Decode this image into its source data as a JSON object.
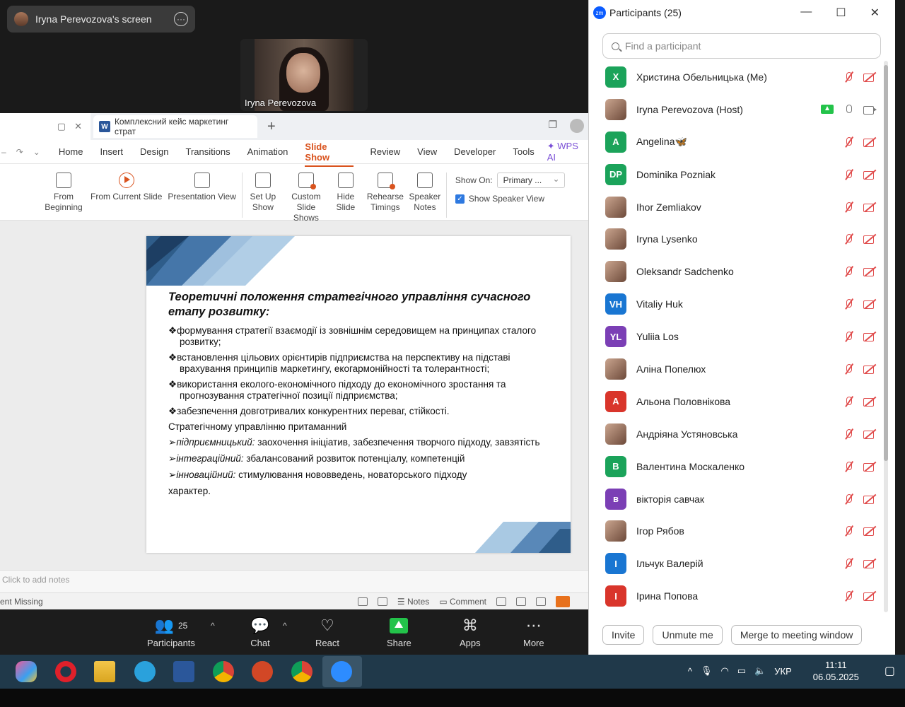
{
  "zoom": {
    "share_label": "Iryna Perevozova's screen",
    "video_name": "Iryna Perevozova",
    "toolbar": {
      "participants_label": "Participants",
      "participants_count": "25",
      "chat_label": "Chat",
      "react_label": "React",
      "share_label": "Share",
      "apps_label": "Apps",
      "more_label": "More"
    }
  },
  "wps": {
    "doc_tab": "Комплексний кейс маркетинг страт",
    "menu": [
      "Home",
      "Insert",
      "Design",
      "Transitions",
      "Animation",
      "Slide Show",
      "Review",
      "View",
      "Developer",
      "Tools"
    ],
    "active_menu": "Slide Show",
    "wps_ai": "WPS AI",
    "ribbon": {
      "from_beginning": "From Beginning",
      "from_current": "From Current Slide",
      "presentation_view": "Presentation View",
      "set_up_show": "Set Up Show",
      "custom_slide_shows": "Custom Slide Shows",
      "hide_slide": "Hide Slide",
      "rehearse_timings": "Rehearse Timings",
      "speaker_notes": "Speaker Notes",
      "show_on_label": "Show On:",
      "show_on_value": "Primary ...",
      "show_speaker_view": "Show Speaker View"
    },
    "slide": {
      "title": "Теоретичні положення стратегічного управління сучасного етапу розвитку:",
      "bullets": [
        "формування стратегії взаємодії із зовнішнім середовищем на принципах сталого розвитку;",
        "встановлення цільових орієнтирів підприємства на перспективу на підставі врахування принципів маркетингу, екогармонійності та толерантності;",
        "використання еколого-економічного підходу до економічного зростання та прогнозування стратегічної позиції підприємства;",
        "забезпечення довготривалих конкурентних переваг, стійкості."
      ],
      "intro": "Стратегічному управлінню притаманний",
      "arrows": [
        {
          "term": "підприємницький:",
          "text": " заохочення ініціатив, забезпечення творчого підходу, завзятість"
        },
        {
          "term": "інтеграційний:",
          "text": " збалансований розвиток потенціалу, компетенцій"
        },
        {
          "term": "інноваційний:",
          "text": " стимулювання нововведень, новаторського підходу"
        }
      ],
      "ending": "характер."
    },
    "notes_placeholder": "Click to add notes",
    "status_left": "ent Missing",
    "status_notes": "Notes",
    "status_comment": "Comment"
  },
  "participants": {
    "title": "Participants (25)",
    "search_placeholder": "Find a participant",
    "list": [
      {
        "name": "Христина Обельницька (Me)",
        "initials": "Х",
        "color": "#1ba35a",
        "photo": false,
        "host": false
      },
      {
        "name": "Iryna Perevozova (Host)",
        "initials": "",
        "color": "",
        "photo": true,
        "host": true
      },
      {
        "name": "Angelina🦋",
        "initials": "A",
        "color": "#1ba35a",
        "photo": false,
        "host": false
      },
      {
        "name": "Dominika Pozniak",
        "initials": "DP",
        "color": "#1ba35a",
        "photo": false,
        "host": false
      },
      {
        "name": "Ihor Zemliakov",
        "initials": "",
        "color": "",
        "photo": true,
        "host": false
      },
      {
        "name": "Iryna Lysenko",
        "initials": "",
        "color": "",
        "photo": true,
        "host": false
      },
      {
        "name": "Oleksandr Sadchenko",
        "initials": "",
        "color": "",
        "photo": true,
        "host": false
      },
      {
        "name": "Vitaliy Huk",
        "initials": "VH",
        "color": "#1976d2",
        "photo": false,
        "host": false
      },
      {
        "name": "Yuliia Los",
        "initials": "YL",
        "color": "#7b3fb5",
        "photo": false,
        "host": false
      },
      {
        "name": "Аліна Попелюх",
        "initials": "",
        "color": "",
        "photo": true,
        "host": false
      },
      {
        "name": "Альона Половнікова",
        "initials": "A",
        "color": "#d9352b",
        "photo": false,
        "host": false
      },
      {
        "name": "Андріяна Устяновська",
        "initials": "",
        "color": "",
        "photo": true,
        "host": false
      },
      {
        "name": "Валентина Москаленко",
        "initials": "B",
        "color": "#1ba35a",
        "photo": false,
        "host": false
      },
      {
        "name": "вікторія савчак",
        "initials": "в",
        "color": "#7b3fb5",
        "photo": false,
        "host": false
      },
      {
        "name": "Ігор Рябов",
        "initials": "",
        "color": "",
        "photo": true,
        "host": false
      },
      {
        "name": "Ільчук Валерій",
        "initials": "І",
        "color": "#1976d2",
        "photo": false,
        "host": false
      },
      {
        "name": "Ірина Попова",
        "initials": "І",
        "color": "#d9352b",
        "photo": false,
        "host": false
      }
    ],
    "invite_label": "Invite",
    "unmute_label": "Unmute me",
    "merge_label": "Merge to meeting window"
  },
  "taskbar": {
    "lang": "УКР",
    "time": "11:11",
    "date": "06.05.2025"
  }
}
